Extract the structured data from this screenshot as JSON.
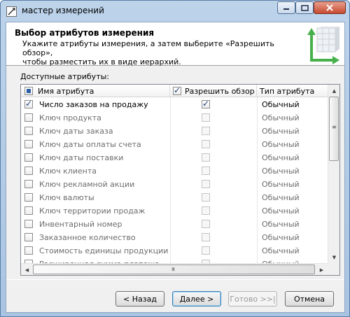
{
  "window": {
    "title": "мастер измерений",
    "controls": {
      "minimize_icon": "minimize-icon",
      "maximize_icon": "maximize-icon",
      "close_icon": "close-icon"
    }
  },
  "header": {
    "title": "Выбор атрибутов измерения",
    "description_line1": "Укажите атрибуты измерения, а затем выберите «Разрешить обзор»,",
    "description_line2": "чтобы разместить их в виде иерархий."
  },
  "attributes": {
    "label": "Доступные атрибуты:",
    "columns": {
      "name": "Имя атрибута",
      "browse": "Разрешить обзор",
      "type": "Тип атрибута"
    },
    "rows": [
      {
        "name": "Число заказов на продажу",
        "checked": true,
        "browse": true,
        "type": "Обычный",
        "enabled": true
      },
      {
        "name": "Ключ продукта",
        "checked": false,
        "browse": false,
        "type": "Обычный",
        "enabled": false
      },
      {
        "name": "Ключ даты заказа",
        "checked": false,
        "browse": false,
        "type": "Обычный",
        "enabled": false
      },
      {
        "name": "Ключ даты оплаты счета",
        "checked": false,
        "browse": false,
        "type": "Обычный",
        "enabled": false
      },
      {
        "name": "Ключ даты поставки",
        "checked": false,
        "browse": false,
        "type": "Обычный",
        "enabled": false
      },
      {
        "name": "Ключ клиента",
        "checked": false,
        "browse": false,
        "type": "Обычный",
        "enabled": false
      },
      {
        "name": "Ключ рекламной акции",
        "checked": false,
        "browse": false,
        "type": "Обычный",
        "enabled": false
      },
      {
        "name": "Ключ валюты",
        "checked": false,
        "browse": false,
        "type": "Обычный",
        "enabled": false
      },
      {
        "name": "Ключ территории продаж",
        "checked": false,
        "browse": false,
        "type": "Обычный",
        "enabled": false
      },
      {
        "name": "Инвентарный номер",
        "checked": false,
        "browse": false,
        "type": "Обычный",
        "enabled": false
      },
      {
        "name": "Заказанное количество",
        "checked": false,
        "browse": false,
        "type": "Обычный",
        "enabled": false
      },
      {
        "name": "Стоимость единицы продукции",
        "checked": false,
        "browse": false,
        "type": "Обычный",
        "enabled": false
      },
      {
        "name": "Расширенная сумма платежа",
        "checked": false,
        "browse": false,
        "type": "Обычный",
        "enabled": false
      }
    ]
  },
  "buttons": {
    "back": "< Назад",
    "next": "Далее >",
    "finish": "Готово >>|",
    "cancel": "Отмена"
  }
}
